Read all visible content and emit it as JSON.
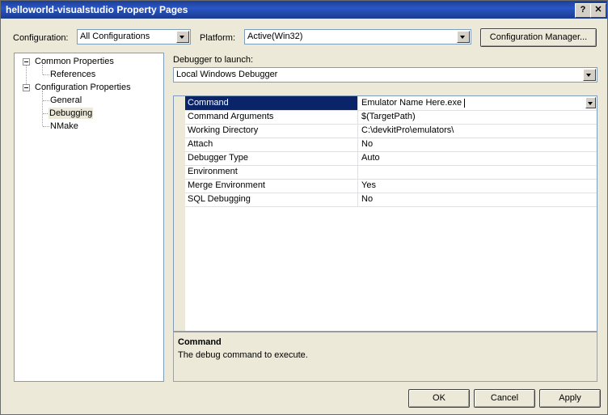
{
  "window": {
    "title": "helloworld-visualstudio Property Pages",
    "help_label": "?",
    "close_label": "✕"
  },
  "toolbar": {
    "configuration_label": "Configuration:",
    "configuration_value": "All Configurations",
    "platform_label": "Platform:",
    "platform_value": "Active(Win32)",
    "config_manager_label": "Configuration Manager..."
  },
  "tree": {
    "items": [
      {
        "label": "Common Properties"
      },
      {
        "label": "References"
      },
      {
        "label": "Configuration Properties"
      },
      {
        "label": "General"
      },
      {
        "label": "Debugging"
      },
      {
        "label": "NMake"
      }
    ]
  },
  "debugger": {
    "label": "Debugger to launch:",
    "value": "Local Windows Debugger"
  },
  "properties": {
    "rows": [
      {
        "name": "Command",
        "value": "Emulator Name Here.exe"
      },
      {
        "name": "Command Arguments",
        "value": " $(TargetPath)"
      },
      {
        "name": "Working Directory",
        "value": "C:\\devkitPro\\emulators\\"
      },
      {
        "name": "Attach",
        "value": "No"
      },
      {
        "name": "Debugger Type",
        "value": "Auto"
      },
      {
        "name": "Environment",
        "value": ""
      },
      {
        "name": "Merge Environment",
        "value": "Yes"
      },
      {
        "name": "SQL Debugging",
        "value": "No"
      }
    ]
  },
  "description": {
    "title": "Command",
    "text": "The debug command to execute."
  },
  "buttons": {
    "ok": "OK",
    "cancel": "Cancel",
    "apply": "Apply"
  }
}
